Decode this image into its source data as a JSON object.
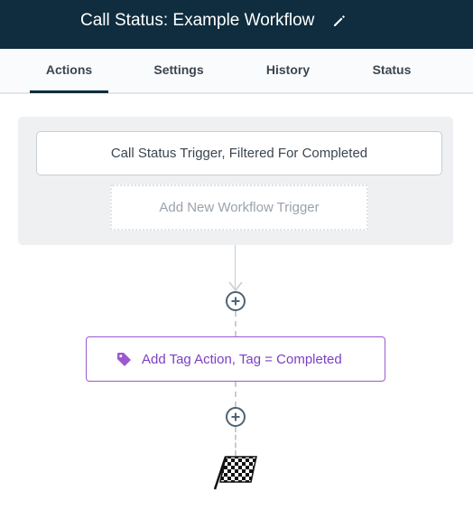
{
  "header": {
    "title": "Call Status: Example Workflow",
    "edit_icon": "pencil-icon",
    "background": "#0f2d3e"
  },
  "tabs": [
    {
      "label": "Actions",
      "active": true
    },
    {
      "label": "Settings",
      "active": false
    },
    {
      "label": "History",
      "active": false
    },
    {
      "label": "Status",
      "active": false
    }
  ],
  "trigger_panel": {
    "trigger_label": "Call Status Trigger, Filtered For Completed",
    "add_trigger_label": "Add New Workflow Trigger"
  },
  "action": {
    "label": "Add Tag Action, Tag = Completed",
    "icon": "tag-icon",
    "accent": "#9b59d0"
  },
  "end_icon": "checkered-flag-icon"
}
